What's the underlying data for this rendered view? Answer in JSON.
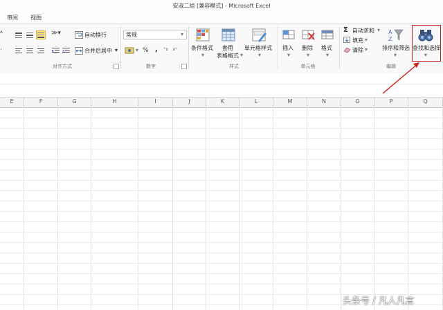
{
  "window": {
    "title": "安淑二组 [兼容模式] - Microsoft Excel"
  },
  "tabs": [
    {
      "label": "审阅"
    },
    {
      "label": "视图"
    }
  ],
  "ribbon": {
    "alignment": {
      "wrap_text": "自动换行",
      "merge_center": "合并后居中",
      "group_label": "对齐方式"
    },
    "number": {
      "format_value": "常规",
      "percent": "%",
      "comma": ",",
      "group_label": "数字"
    },
    "styles": {
      "conditional_format": "条件格式",
      "table_format_line1": "套用",
      "table_format_line2": "表格格式",
      "cell_styles": "单元格样式",
      "group_label": "样式"
    },
    "cells": {
      "insert": "插入",
      "delete": "删除",
      "format": "格式",
      "group_label": "单元格"
    },
    "editing": {
      "autosum": "自动求和",
      "fill": "填充",
      "clear": "清除",
      "sort_filter": "排序和筛选",
      "find_select": "查找和选择",
      "group_label": "编辑"
    }
  },
  "columns": [
    "E",
    "F",
    "G",
    "H",
    "I",
    "J",
    "K",
    "L",
    "M",
    "N",
    "O",
    "P",
    "Q"
  ],
  "annotation": {
    "highlight_color": "#d01e1e"
  },
  "watermark": "头条号 / 凡人凡言"
}
